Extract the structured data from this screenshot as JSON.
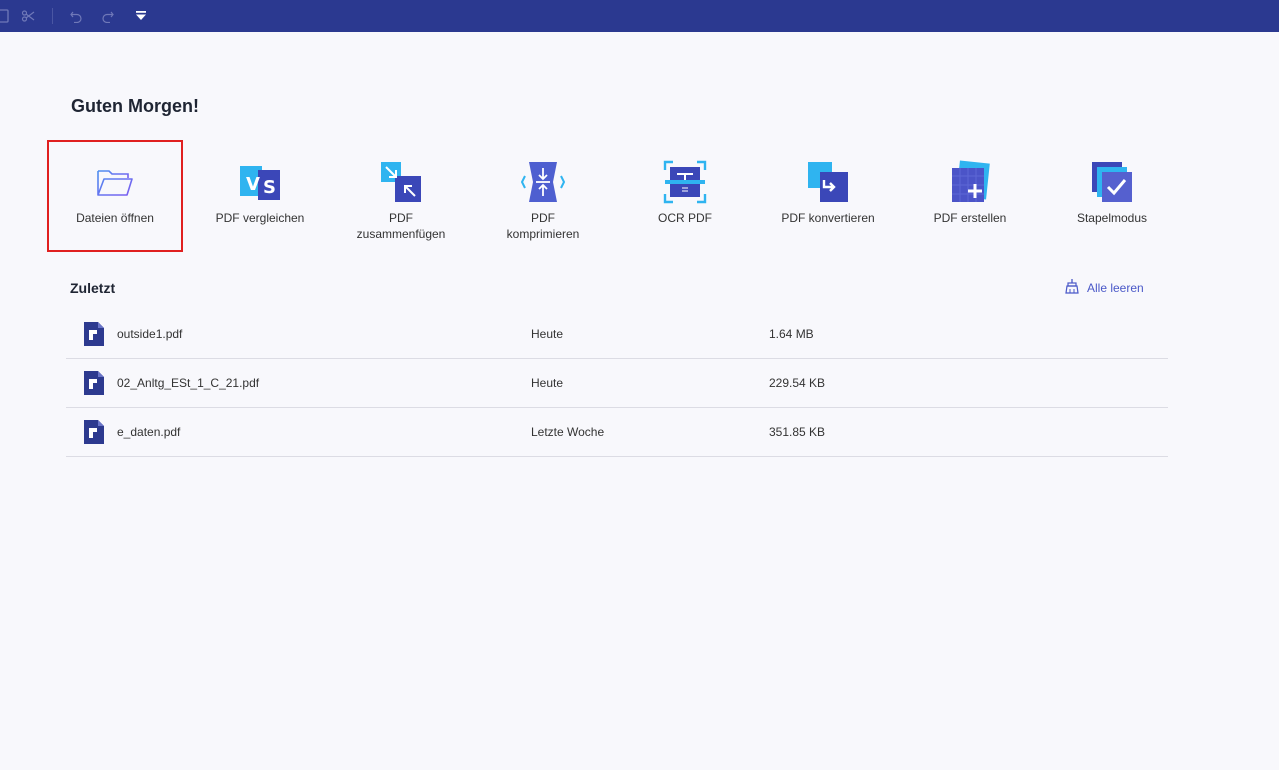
{
  "toolbar": {
    "icons": [
      "save-icon",
      "scissors-icon",
      "undo-icon",
      "redo-icon",
      "quick-access-dropdown-icon"
    ]
  },
  "greeting": "Guten Morgen!",
  "tools": [
    {
      "id": "open-files",
      "label": "Dateien öffnen",
      "selected": true
    },
    {
      "id": "compare-pdf",
      "label": "PDF vergleichen"
    },
    {
      "id": "merge-pdf",
      "label_line1": "PDF",
      "label_line2": "zusammenfügen"
    },
    {
      "id": "compress-pdf",
      "label_line1": "PDF",
      "label_line2": "komprimieren"
    },
    {
      "id": "ocr-pdf",
      "label": "OCR PDF"
    },
    {
      "id": "convert-pdf",
      "label": "PDF konvertieren"
    },
    {
      "id": "create-pdf",
      "label": "PDF erstellen"
    },
    {
      "id": "batch-mode",
      "label": "Stapelmodus"
    }
  ],
  "recent": {
    "title": "Zuletzt",
    "clear_label": "Alle leeren",
    "files": [
      {
        "name": "outside1.pdf",
        "date": "Heute",
        "size": "1.64 MB"
      },
      {
        "name": "02_Anltg_ESt_1_C_21.pdf",
        "date": "Heute",
        "size": "229.54 KB"
      },
      {
        "name": "e_daten.pdf",
        "date": "Letzte Woche",
        "size": "351.85 KB"
      }
    ]
  },
  "colors": {
    "topbar": "#2b3990",
    "accent": "#4a58c8",
    "selection_border": "#e02020",
    "background": "#f8f8fc"
  }
}
